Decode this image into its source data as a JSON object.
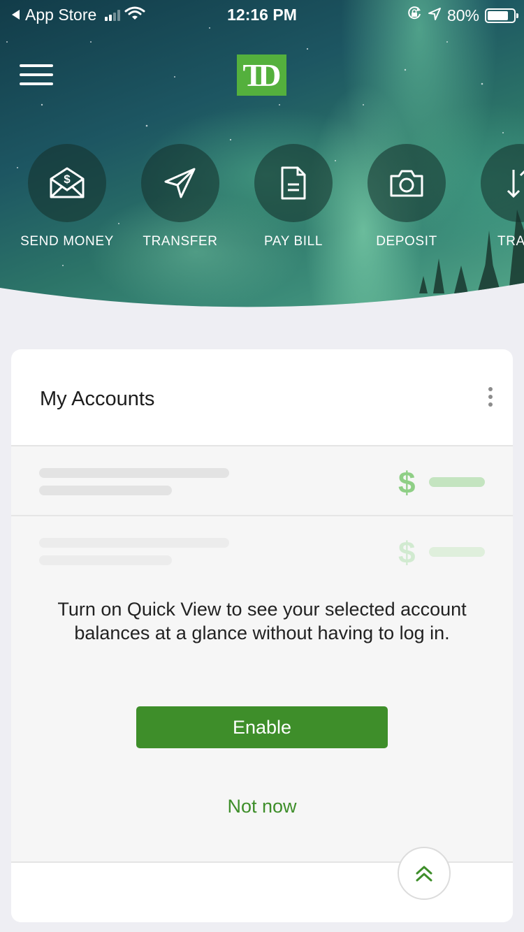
{
  "status_bar": {
    "back_app": "App Store",
    "time": "12:16 PM",
    "battery": "80%"
  },
  "header": {
    "logo_text": "TD"
  },
  "actions": [
    {
      "label": "SEND MONEY",
      "icon": "envelope-dollar-icon"
    },
    {
      "label": "TRANSFER",
      "icon": "paper-plane-icon"
    },
    {
      "label": "PAY BILL",
      "icon": "document-icon"
    },
    {
      "label": "DEPOSIT",
      "icon": "camera-icon"
    },
    {
      "label": "TRA",
      "icon": "transfer-arrows-icon"
    }
  ],
  "accounts_card": {
    "title": "My Accounts",
    "placeholder_symbol": "$",
    "message": "Turn on Quick View to see your selected account balances at a glance without having to log in.",
    "enable_label": "Enable",
    "not_now_label": "Not now"
  },
  "colors": {
    "brand_green": "#54b03d",
    "button_green": "#3e8e2a",
    "page_bg": "#eeeef3"
  }
}
